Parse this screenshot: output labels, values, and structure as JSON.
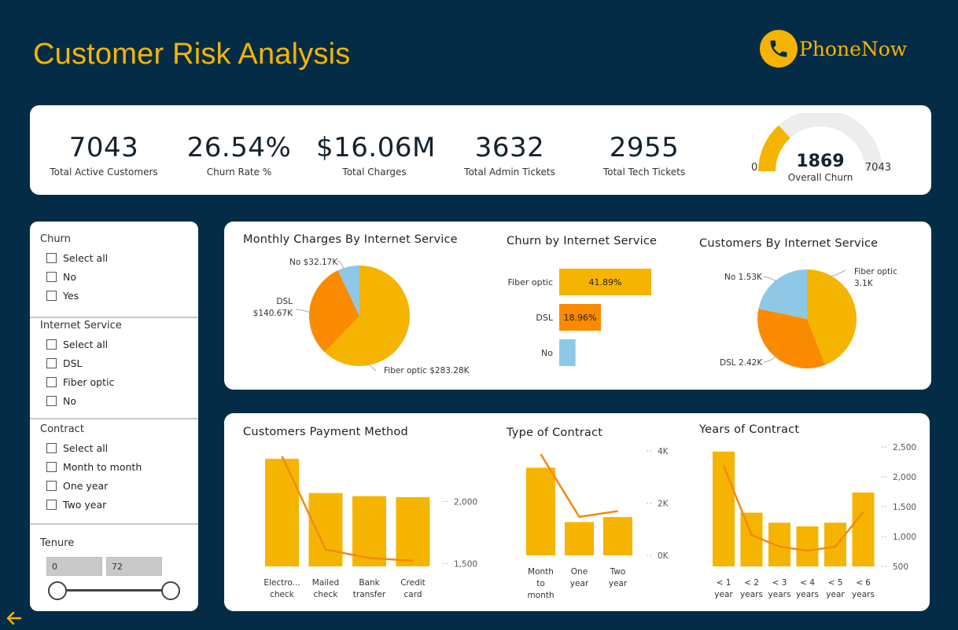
{
  "header": {
    "title": "Customer Risk Analysis",
    "logo_text": "PhoneNow"
  },
  "colors": {
    "background": "#052c46",
    "accent": "#f5b400",
    "orange": "#fa8a00",
    "lightblue": "#8ec8e6"
  },
  "kpis": [
    {
      "value": "7043",
      "label": "Total Active Customers"
    },
    {
      "value": "26.54%",
      "label": "Churn Rate %"
    },
    {
      "value": "$16.06M",
      "label": "Total Charges"
    },
    {
      "value": "3632",
      "label": "Total Admin Tickets"
    },
    {
      "value": "2955",
      "label": "Total Tech Tickets"
    }
  ],
  "gauge": {
    "value": "1869",
    "min": "0",
    "max": "7043",
    "label": "Overall Churn",
    "fraction": 0.2654
  },
  "filters": {
    "churn": {
      "title": "Churn",
      "options": [
        "Select all",
        "No",
        "Yes"
      ]
    },
    "internet": {
      "title": "Internet Service",
      "options": [
        "Select all",
        "DSL",
        "Fiber optic",
        "No"
      ]
    },
    "contract": {
      "title": "Contract",
      "options": [
        "Select all",
        "Month to month",
        "One year",
        "Two year"
      ]
    },
    "tenure": {
      "title": "Tenure",
      "min": "0",
      "max": "72"
    }
  },
  "chart_data": [
    {
      "type": "pie",
      "title": "Monthly Charges By Internet Service",
      "slices": [
        {
          "label": "Fiber optic $283.28K",
          "value": 283.28,
          "color": "#f5b400"
        },
        {
          "label": "DSL $140.67K",
          "value": 140.67,
          "color": "#fa8a00"
        },
        {
          "label": "No $32.17K",
          "value": 32.17,
          "color": "#8ec8e6"
        }
      ],
      "labels": {
        "fiber": "Fiber optic $283.28K",
        "dsl1": "DSL",
        "dsl2": "$140.67K",
        "no": "No $32.17K"
      }
    },
    {
      "type": "bar",
      "title": "Churn by Internet Service",
      "categories": [
        "Fiber optic",
        "DSL",
        "No"
      ],
      "values": [
        41.89,
        18.96,
        7.4
      ],
      "data_labels": [
        "41.89%",
        "18.96%",
        ""
      ],
      "colors": [
        "#f5b400",
        "#fa8a00",
        "#8ec8e6"
      ]
    },
    {
      "type": "pie",
      "title": "Customers By Internet Service",
      "slices": [
        {
          "label": "Fiber optic 3.1K",
          "value": 3.1,
          "color": "#f5b400"
        },
        {
          "label": "DSL 2.42K",
          "value": 2.42,
          "color": "#fa8a00"
        },
        {
          "label": "No 1.53K",
          "value": 1.53,
          "color": "#8ec8e6"
        }
      ],
      "labels": {
        "fiber1": "Fiber optic",
        "fiber2": "3.1K",
        "dsl": "DSL 2.42K",
        "no": "No 1.53K"
      }
    },
    {
      "type": "bar",
      "title": "Customers Payment Method",
      "categories": [
        [
          "Electro...",
          "check"
        ],
        [
          "Mailed",
          "check"
        ],
        [
          "Bank",
          "transfer"
        ],
        [
          "Credit",
          "card"
        ]
      ],
      "values": [
        2365,
        1612,
        1544,
        1522
      ],
      "line_values": [
        2365,
        1612,
        1544,
        1522
      ],
      "yticks": [
        {
          "value": 1500,
          "label": "1,500"
        },
        {
          "value": 2000,
          "label": "2,000"
        }
      ],
      "line_range": [
        1420,
        2420
      ],
      "bar_max": 2540
    },
    {
      "type": "bar",
      "title": "Type of Contract",
      "categories": [
        [
          "Month",
          "to",
          "month"
        ],
        [
          "One",
          "year"
        ],
        [
          "Two",
          "year"
        ]
      ],
      "values": [
        3875,
        1473,
        1695
      ],
      "line_values": [
        3875,
        1473,
        1695
      ],
      "yticks": [
        {
          "value": 0,
          "label": "0K"
        },
        {
          "value": 2000,
          "label": "2K"
        },
        {
          "value": 4000,
          "label": "4K"
        }
      ],
      "line_range": [
        0,
        4000
      ],
      "bar_max": 4550
    },
    {
      "type": "bar",
      "title": "Years of Contract",
      "categories": [
        [
          "< 1",
          "year"
        ],
        [
          "< 2",
          "years"
        ],
        [
          "< 3",
          "years"
        ],
        [
          "< 4",
          "years"
        ],
        [
          "< 5",
          "year"
        ],
        [
          "< 6",
          "years"
        ]
      ],
      "values": [
        2186,
        1024,
        832,
        762,
        832,
        1407
      ],
      "line_values": [
        2186,
        1024,
        832,
        762,
        832,
        1407
      ],
      "yticks": [
        {
          "value": 500,
          "label": "500"
        },
        {
          "value": 1000,
          "label": "1,000"
        },
        {
          "value": 1500,
          "label": "1,500"
        },
        {
          "value": 2000,
          "label": "2,000"
        },
        {
          "value": 2500,
          "label": "2,500"
        }
      ],
      "line_range": [
        500,
        2500
      ],
      "bar_max": 2200
    }
  ]
}
